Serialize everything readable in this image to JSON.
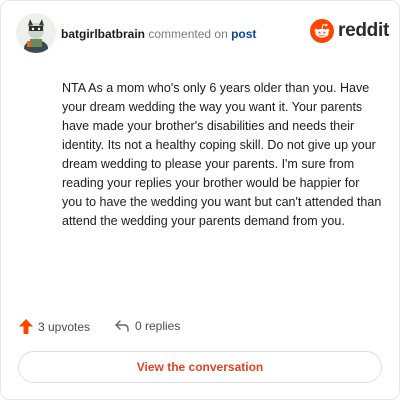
{
  "header": {
    "username": "batgirlbatbrain",
    "action_text": "commented on",
    "post_link": "post"
  },
  "brand": {
    "logo_word": "reddit",
    "accent_color": "#ff4500",
    "icon": "reddit-snoo-icon"
  },
  "comment": {
    "text": "NTA As a mom who's only 6 years older than you. Have your dream wedding the way you want it. Your parents have made your brother's disabilities and needs their identity. Its not a healthy coping skill. Do not give up your dream wedding to please your parents. I'm sure from reading your replies your brother would be happier for you to have the wedding you want but can't attended than attend the wedding your parents demand from you."
  },
  "footer": {
    "upvotes_label": "3 upvotes",
    "replies_label": "0 replies",
    "upvote_icon": "upvote-arrow-icon",
    "reply_icon": "reply-arrow-icon",
    "upvote_color": "#ff4500"
  },
  "cta": {
    "label": "View the conversation",
    "color": "#e0441d"
  }
}
